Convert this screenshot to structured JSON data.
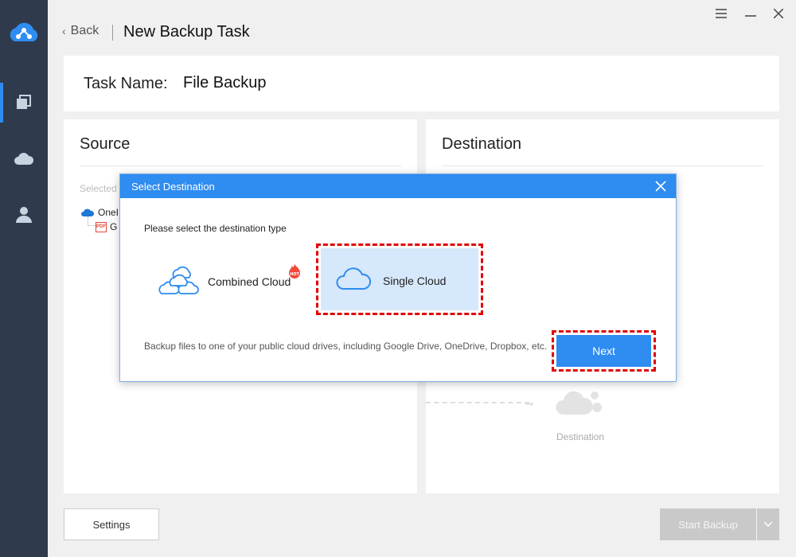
{
  "window": {
    "title": "New Backup Task",
    "back_label": "Back"
  },
  "task": {
    "name_label": "Task Name:",
    "name_value": "File Backup"
  },
  "panels": {
    "source_title": "Source",
    "destination_title": "Destination",
    "selected_label": "Selected",
    "tree_root_label": "OneI",
    "tree_child_label": "G",
    "destination_placeholder": "Destination"
  },
  "footer": {
    "settings_label": "Settings",
    "start_backup_label": "Start Backup"
  },
  "dialog": {
    "title": "Select Destination",
    "prompt": "Please select the destination type",
    "options": [
      {
        "label": "Combined Cloud",
        "badge": "HOT",
        "icon": "multi-cloud-icon",
        "selected": false
      },
      {
        "label": "Single Cloud",
        "icon": "cloud-icon",
        "selected": true
      }
    ],
    "description": "Backup files to one of your public cloud drives, including Google Drive, OneDrive, Dropbox, etc.",
    "next_label": "Next"
  },
  "colors": {
    "accent": "#2f8cf0",
    "rail": "#2f3a4d",
    "highlight_outline": "#e00000",
    "selected_bg": "#d6e8fb"
  },
  "icons": {
    "rail": [
      "app-logo-icon",
      "backup-tasks-icon",
      "cloud-icon",
      "user-icon"
    ],
    "window": [
      "menu-icon",
      "minimize-icon",
      "close-icon"
    ]
  }
}
